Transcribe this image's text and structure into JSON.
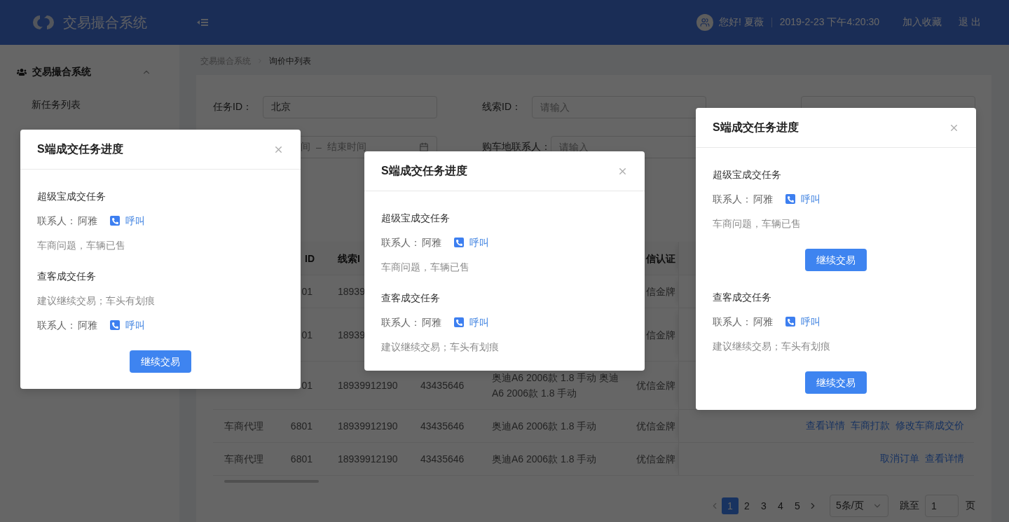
{
  "header": {
    "title": "交易撮合系统",
    "greeting": "您好! 夏薇",
    "datetime": "2019-2-23 下午4:20:30",
    "links": [
      "加入收藏",
      "退 出"
    ]
  },
  "sidebar": {
    "group": {
      "label": "交易撮合系统",
      "expanded": true
    },
    "items": [
      {
        "label": "新任务列表",
        "selected": false
      }
    ]
  },
  "breadcrumb": [
    "交易撮合系统",
    "询价中列表"
  ],
  "filters": [
    {
      "kind": "text",
      "label": "任务ID：",
      "value": "北京"
    },
    {
      "kind": "text",
      "label": "线索ID：",
      "placeholder": "请输入"
    },
    {
      "kind": "text"
    },
    {
      "kind": "date_range",
      "start_placeholder": "间",
      "separator": "–",
      "end_placeholder": "结束时间"
    },
    {
      "kind": "text",
      "label": "购车地联系人：",
      "placeholder": "请输入"
    }
  ],
  "table": {
    "header": {
      "task_id": "ID",
      "clue_id": "线索I",
      "certification": "信认证"
    },
    "rows": [
      {
        "task_id": "01",
        "clue_id": "18939",
        "certification": "信金牌"
      },
      {
        "task_id": "01",
        "clue_id": "18939",
        "certification": "信金牌"
      },
      {
        "task_id": "01",
        "clue_id": "18939912190",
        "vehicle_id": "43435646",
        "model": "奥迪A6 2006款 1.8 手动 奥迪A6 2006款 1.8 手动",
        "certification": "优信金牌"
      },
      {
        "type": "车商代理",
        "task_id": "6801",
        "clue_id": "18939912190",
        "vehicle_id": "43435646",
        "model": "奥迪A6 2006款 1.8 手动",
        "certification": "优信金牌",
        "actions": [
          "查看详情",
          "车商打款",
          "修改车商成交价"
        ]
      },
      {
        "type": "车商代理",
        "task_id": "6801",
        "clue_id": "18939912190",
        "vehicle_id": "43435646",
        "model": "奥迪A6 2006款 1.8 手动",
        "certification": "优信金牌",
        "actions": [
          "取消订单",
          "查看详情"
        ]
      }
    ]
  },
  "pagination": {
    "pages": [
      {
        "label": "1",
        "selected": true
      },
      {
        "label": "2",
        "selected": false
      },
      {
        "label": "3",
        "selected": false
      },
      {
        "label": "4",
        "selected": false
      },
      {
        "label": "5",
        "selected": false
      }
    ],
    "page_size": "5条/页",
    "jump_label": "跳至",
    "jump_value": "1",
    "page_suffix": "页"
  },
  "modals": [
    {
      "title": "S端成交任务进度",
      "blocks": [
        {
          "kind": "heading",
          "text": "超级宝成交任务"
        },
        {
          "kind": "contact",
          "label": "联系人：",
          "name": "阿雅",
          "action": "呼叫"
        },
        {
          "kind": "note",
          "text": "车商问题，车辆已售"
        },
        {
          "kind": "heading",
          "text": "查客成交任务"
        },
        {
          "kind": "note",
          "text": "建议继续交易；车头有划痕"
        },
        {
          "kind": "contact",
          "label": "联系人：",
          "name": "阿雅",
          "action": "呼叫"
        },
        {
          "kind": "button",
          "label": "继续交易"
        }
      ]
    },
    {
      "title": "S端成交任务进度",
      "blocks": [
        {
          "kind": "heading",
          "text": "超级宝成交任务"
        },
        {
          "kind": "contact",
          "label": "联系人：",
          "name": "阿雅",
          "action": "呼叫"
        },
        {
          "kind": "note",
          "text": "车商问题，车辆已售"
        },
        {
          "kind": "heading",
          "text": "查客成交任务"
        },
        {
          "kind": "contact",
          "label": "联系人：",
          "name": "阿雅",
          "action": "呼叫"
        },
        {
          "kind": "note",
          "text": "建议继续交易；车头有划痕"
        }
      ]
    },
    {
      "title": "S端成交任务进度",
      "blocks": [
        {
          "kind": "heading",
          "text": "超级宝成交任务"
        },
        {
          "kind": "contact",
          "label": "联系人：",
          "name": "阿雅",
          "action": "呼叫"
        },
        {
          "kind": "note",
          "text": "车商问题，车辆已售"
        },
        {
          "kind": "button",
          "label": "继续交易"
        },
        {
          "kind": "heading",
          "text": "查客成交任务"
        },
        {
          "kind": "contact",
          "label": "联系人：",
          "name": "阿雅",
          "action": "呼叫"
        },
        {
          "kind": "note",
          "text": "建议继续交易；车头有划痕"
        },
        {
          "kind": "button",
          "label": "继续交易"
        }
      ]
    }
  ]
}
